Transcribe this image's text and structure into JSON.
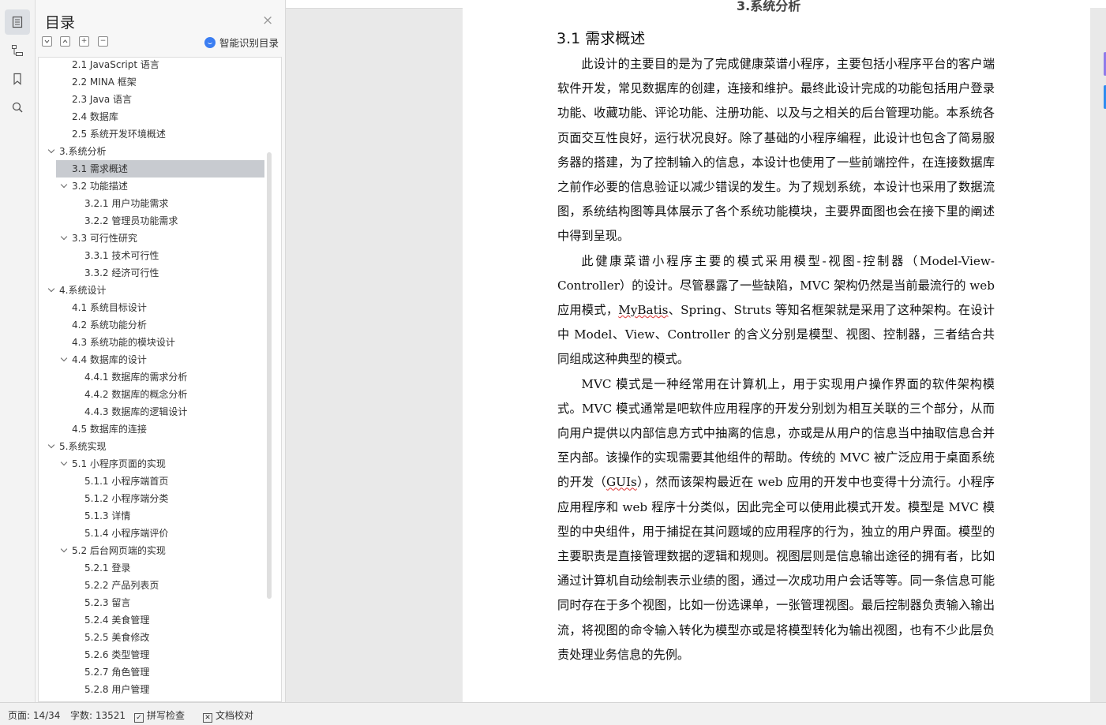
{
  "panel": {
    "title": "目录",
    "close": "×",
    "ai_label": "智能识别目录",
    "tool_expand": "⊞",
    "tool_collapse": "⊟",
    "tool_add": "+",
    "tool_remove": "−"
  },
  "toc": [
    {
      "label": "2.1 JavaScript 语言"
    },
    {
      "label": "2.2 MINA 框架"
    },
    {
      "label": "2.3 Java 语言"
    },
    {
      "label": "2.4  数据库"
    },
    {
      "label": "2.5  系统开发环境概述"
    },
    {
      "label": "3.系统分析"
    },
    {
      "label": "3.1  需求概述"
    },
    {
      "label": "3.2  功能描述"
    },
    {
      "label": "3.2.1  用户功能需求"
    },
    {
      "label": "3.2.2  管理员功能需求"
    },
    {
      "label": "3.3  可行性研究"
    },
    {
      "label": "3.3.1  技术可行性"
    },
    {
      "label": "3.3.2  经济可行性"
    },
    {
      "label": "4.系统设计"
    },
    {
      "label": "4.1  系统目标设计"
    },
    {
      "label": "4.2  系统功能分析"
    },
    {
      "label": "4.3  系统功能的模块设计"
    },
    {
      "label": "4.4  数据库的设计"
    },
    {
      "label": "4.4.1  数据库的需求分析"
    },
    {
      "label": "4.4.2  数据库的概念分析"
    },
    {
      "label": "4.4.3  数据库的逻辑设计"
    },
    {
      "label": "4.5  数据库的连接"
    },
    {
      "label": "5.系统实现"
    },
    {
      "label": "5.1  小程序页面的实现"
    },
    {
      "label": "5.1.1 小程序端首页"
    },
    {
      "label": "5.1.2 小程序端分类"
    },
    {
      "label": "5.1.3 详情"
    },
    {
      "label": "5.1.4 小程序端评价"
    },
    {
      "label": "5.2  后台网页端的实现"
    },
    {
      "label": "5.2.1 登录"
    },
    {
      "label": "5.2.2 产品列表页"
    },
    {
      "label": "5.2.3  留言"
    },
    {
      "label": "5.2.4 美食管理"
    },
    {
      "label": "5.2.5 美食修改"
    },
    {
      "label": "5.2.6 类型管理"
    },
    {
      "label": "5.2.7 角色管理"
    },
    {
      "label": "5.2.8 用户管理"
    }
  ],
  "doc": {
    "heading_peek": "3.系统分析",
    "section_title": "3.1  需求概述",
    "p1": "此设计的主要目的是为了完成健康菜谱小程序，主要包括小程序平台的客户端软件开发，常见数据库的创建，连接和维护。最终此设计完成的功能包括用户登录功能、收藏功能、评论功能、注册功能、以及与之相关的后台管理功能。本系统各页面交互性良好，运行状况良好。除了基础的小程序编程，此设计也包含了简易服务器的搭建，为了控制输入的信息，本设计也使用了一些前端控件，在连接数据库之前作必要的信息验证以减少错误的发生。为了规划系统，本设计也采用了数据流图，系统结构图等具体展示了各个系统功能模块，主要界面图也会在接下里的阐述中得到呈现。",
    "p2_a": "此健康菜谱小程序主要的模式采用模型-视图-控制器（Model-View-Controller）的设计。尽管暴露了一些缺陷，MVC 架构仍然是当前最流行的 web 应用模式，",
    "p2_mybatis": "MyBatis",
    "p2_b": "、Spring、Struts 等知名框架就是采用了这种架构。在设计中 Model、View、Controller 的含义分别是模型、视图、控制器，三者结合共同组成这种典型的模式。",
    "p3_a": "MVC 模式是一种经常用在计算机上，用于实现用户操作界面的软件架构模式。MVC 模式通常是吧软件应用程序的开发分别划为相互关联的三个部分，从而向用户提供以内部信息方式中抽离的信息，亦或是从用户的信息当中抽取信息合并至内部。该操作的实现需要其他组件的帮助。传统的 MVC 被广泛应用于桌面系统的开发（",
    "p3_guis": "GUIs",
    "p3_b": "），然而该架构最近在 web 应用的开发中也变得十分流行。小程序应用程序和 web 程序十分类似，因此完全可以使用此模式开发。模型是 MVC 模型的中央组件，用于捕捉在其问题域的应用程序的行为，独立的用户界面。模型的主要职责是直接管理数据的逻辑和规则。视图层则是信息输出途径的拥有者，比如通过计算机自动绘制表示业绩的图，通过一次成功用户会话等等。同一条信息可能同时存在于多个视图，比如一份选课单，一张管理视图。最后控制器负责输入输出流，将视图的命令输入转化为模型亦或是将模型转化为输出视图，也有不少此层负责处理业务信息的先例。"
  },
  "status": {
    "page": "页面: 14/34",
    "words": "字数: 13521",
    "spell": "拼写检查",
    "proof": "文档校对"
  },
  "colors": {
    "accent": "#3b7ef2",
    "selected_row": "#c8cbd0",
    "edge_tab_purple": "#8f7bea",
    "edge_tab_blue": "#2f8cf0"
  }
}
